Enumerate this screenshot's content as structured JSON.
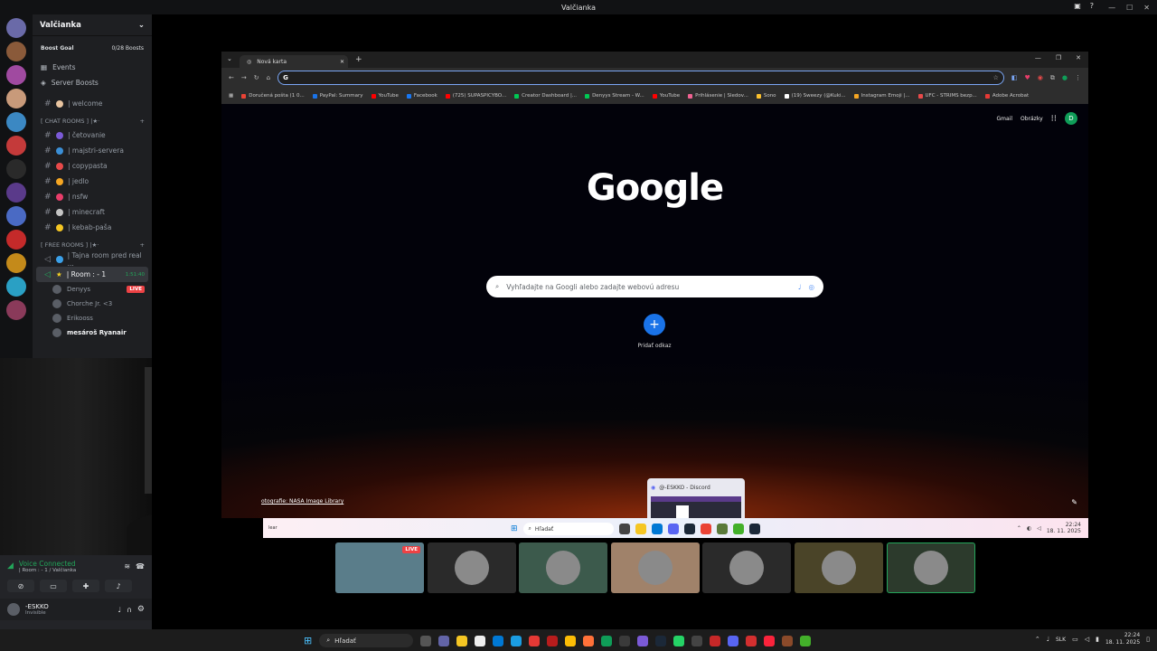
{
  "window": {
    "title": "Valčianka"
  },
  "server": {
    "name": "Valčianka",
    "boost_label": "Boost Goal",
    "boost_count": "0/28 Boosts"
  },
  "nav": [
    {
      "label": "Events",
      "icon": "calendar-icon"
    },
    {
      "label": "Server Boosts",
      "icon": "boost-icon"
    }
  ],
  "channels_top": [
    {
      "label": "| welcome"
    }
  ],
  "cat_chat": "[ CHAT ROOMS ] |★·",
  "chat_channels": [
    {
      "label": "| četovanie",
      "color": "#7b5ad6"
    },
    {
      "label": "| majstri-servera",
      "color": "#3b8fd6"
    },
    {
      "label": "| copypasta",
      "color": "#e84a4a"
    },
    {
      "label": "| jedlo",
      "color": "#f5a623"
    },
    {
      "label": "| nsfw",
      "color": "#e83d6a"
    },
    {
      "label": "| minecraft",
      "color": "#c4c4c4"
    },
    {
      "label": "| kebab-paša",
      "color": "#f5c623"
    }
  ],
  "cat_free": "[ FREE ROOMS ] |★·",
  "free_channels": [
    {
      "label": "| Tajna room pred real ...",
      "color": "#3ba0e8"
    },
    {
      "label": "| Room : - 1",
      "time": "1:51:40",
      "color": "#f5d023"
    }
  ],
  "voice_users": [
    {
      "name": "Denyys",
      "live": "LIVE"
    },
    {
      "name": "Chorche Jr. <3",
      "live": ""
    },
    {
      "name": "Erikooss",
      "live": ""
    },
    {
      "name": "mesároš Ryanair",
      "live": ""
    }
  ],
  "voice": {
    "status": "Voice Connected",
    "where": "| Room : - 1 / Valčianka"
  },
  "me": {
    "name": "-ESKKO",
    "status": "Invisible"
  },
  "browser": {
    "tab_title": "Nová karta",
    "bookmarks": [
      "Doručená pošta (1 0...",
      "PayPal: Summary",
      "YouTube",
      "Facebook",
      "(725) SUPASPICYBO...",
      "Creator Dashboard |...",
      "Denyys Stream - W...",
      "YouTube",
      "Prihlásenie | Sledov...",
      "Sono",
      "(19) Sweezy (@Kuki...",
      "Instagram Emoji |...",
      "UFC - STRIMS bezp...",
      "Adobe Acrobat"
    ],
    "bookmark_colors": [
      "#ea4335",
      "#1a73e8",
      "#ff0000",
      "#1877f2",
      "#ff0000",
      "#00c853",
      "#00c853",
      "#ff0000",
      "#f06292",
      "#fbc02d",
      "#ffffff",
      "#f5a623",
      "#e84a4a",
      "#e53935"
    ],
    "gmail": "Gmail",
    "images": "Obrázky",
    "avatar_letter": "D",
    "logo": "Google",
    "search_placeholder": "Vyhľadajte na Googli alebo zadajte webovú adresu",
    "shortcut_label": "Pridať odkaz",
    "photo_credit": "otografie: NASA Image Library",
    "thumb_title": "@-ESKKO - Discord",
    "inner_search": "Hľadať",
    "inner_time": "22:24",
    "inner_date": "18. 11. 2025"
  },
  "taskbar": {
    "search": "Hľadať",
    "lang": "SLK",
    "time": "22:24",
    "date": "18. 11. 2025"
  },
  "tiles": [
    {
      "bg": "#5a7d8a",
      "live": "LIVE"
    },
    {
      "bg": "#2a2a2a",
      "live": ""
    },
    {
      "bg": "#3c5a4c",
      "live": ""
    },
    {
      "bg": "#a0826a",
      "live": ""
    },
    {
      "bg": "#2a2a2a",
      "live": ""
    },
    {
      "bg": "#4a4428",
      "live": ""
    },
    {
      "bg": "#2c3a2c",
      "live": ""
    }
  ]
}
